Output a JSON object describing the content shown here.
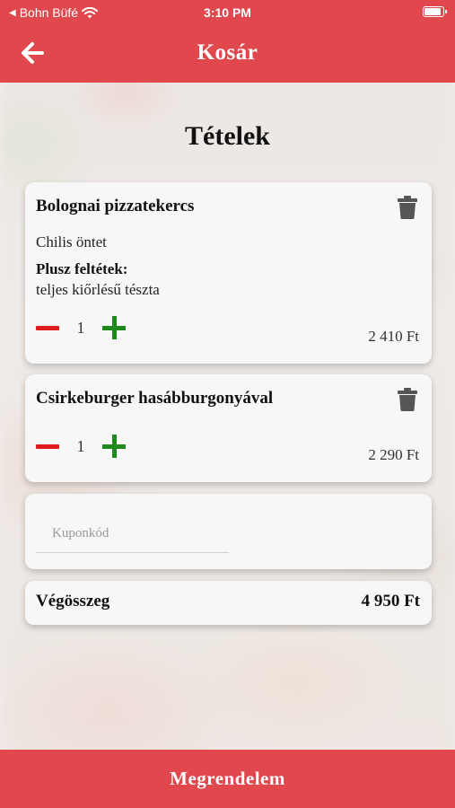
{
  "status_bar": {
    "back_app": "Bohn Büfé",
    "time": "3:10 PM"
  },
  "header": {
    "title": "Kosár",
    "back_icon": "arrow-left-icon"
  },
  "page_title": "Tételek",
  "cart_items": [
    {
      "name": "Bolognai pizzatekercs",
      "option": "Chilis öntet",
      "extras_label": "Plusz feltétek:",
      "extras": "teljes kiőrlésű tészta",
      "quantity": "1",
      "price": "2 410 Ft"
    },
    {
      "name": "Csirkeburger hasábburgonyával",
      "quantity": "1",
      "price": "2 290 Ft"
    }
  ],
  "coupon": {
    "placeholder": "Kuponkód",
    "value": ""
  },
  "total": {
    "label": "Végösszeg",
    "value": "4 950 Ft"
  },
  "order_button": "Megrendelem",
  "colors": {
    "accent": "#e0484d",
    "minus": "#e01b1b",
    "plus": "#1e8a1e"
  }
}
